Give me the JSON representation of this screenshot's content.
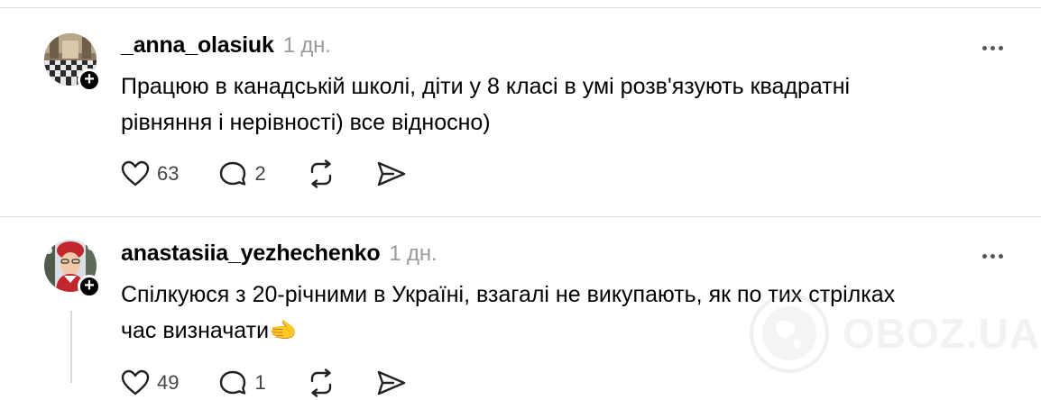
{
  "posts": [
    {
      "username": "_anna_olasiuk",
      "time": "1 дн.",
      "text_line1": "Працюю в канадській школі, діти у 8 класі в умі розв'язують квадратні",
      "text_line2": "рівняння і нерівності) все відносно)",
      "likes": "63",
      "replies": "2"
    },
    {
      "username": "anastasiia_yezhechenko",
      "time": "1 дн.",
      "text_line1": "Спілкуюся з 20-річними в Україні, взагалі не викупають, як по тих стрілках",
      "text_line2": "час визначати🫲",
      "likes": "49",
      "replies": "1"
    }
  ],
  "follow_symbol": "+",
  "watermark": {
    "text": "OBOZ.UA"
  },
  "icons": {
    "like": "heart-icon",
    "reply": "comment-bubble-icon",
    "repost": "repost-icon",
    "share": "send-icon",
    "more": "more-dots-icon"
  }
}
